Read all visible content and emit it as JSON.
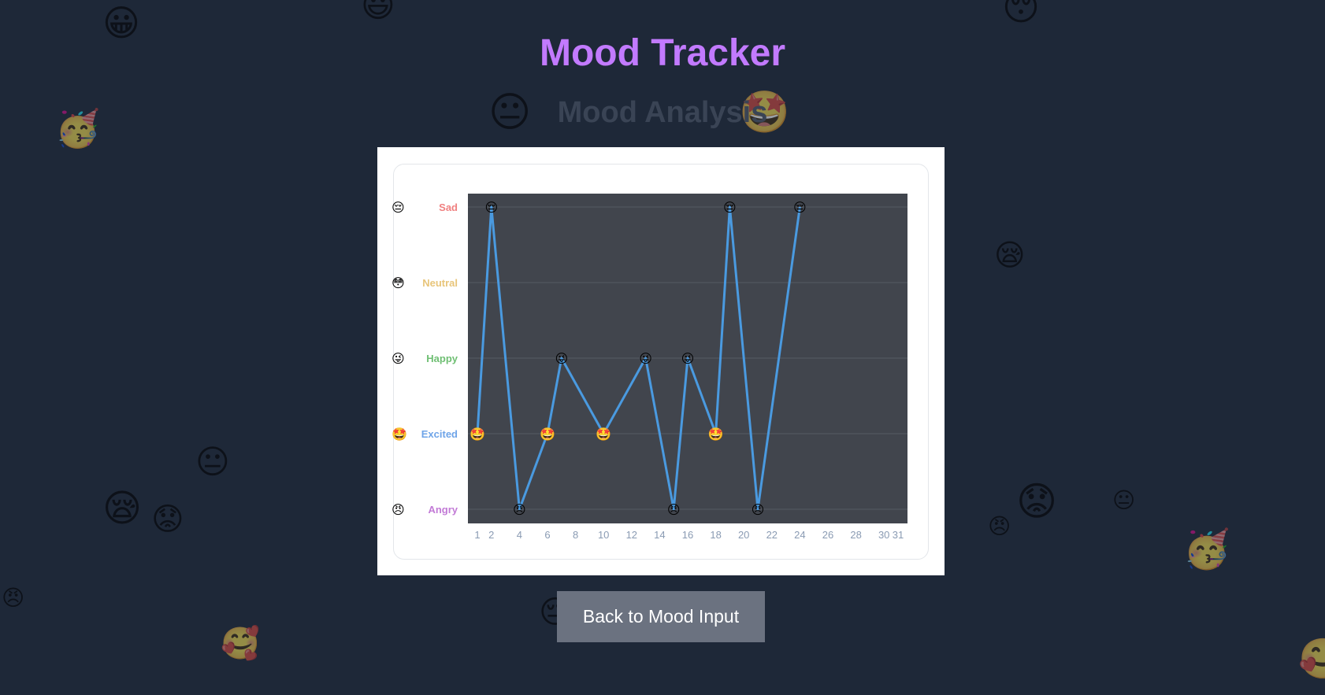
{
  "app": {
    "title": "Mood Tracker",
    "section_title": "Mood Analysis",
    "back_button_label": "Back to Mood Input"
  },
  "background_emojis": [
    {
      "glyph": "😀",
      "name": "grinning-emoji-icon"
    },
    {
      "glyph": "😃",
      "name": "smiley-emoji-icon"
    },
    {
      "glyph": "😴",
      "name": "sleeping-emoji-icon"
    },
    {
      "glyph": "🥳",
      "name": "party-emoji-icon"
    },
    {
      "glyph": "😐",
      "name": "neutral-emoji-icon"
    },
    {
      "glyph": "🤩",
      "name": "star-struck-emoji-icon"
    },
    {
      "glyph": "😪",
      "name": "sleepy-emoji-icon"
    },
    {
      "glyph": "😐",
      "name": "neutral-emoji-icon"
    },
    {
      "glyph": "😪",
      "name": "sleepy-emoji-icon"
    },
    {
      "glyph": "😟",
      "name": "worried-emoji-icon"
    },
    {
      "glyph": "😟",
      "name": "worried-emoji-icon"
    },
    {
      "glyph": "😐",
      "name": "neutral-emoji-icon"
    },
    {
      "glyph": "😠",
      "name": "angry-emoji-icon"
    },
    {
      "glyph": "🥳",
      "name": "party-emoji-icon"
    },
    {
      "glyph": "😠",
      "name": "angry-emoji-icon"
    },
    {
      "glyph": "🥰",
      "name": "smiling-hearts-emoji-icon"
    },
    {
      "glyph": "😔",
      "name": "pensive-emoji-icon"
    },
    {
      "glyph": "🥰",
      "name": "smiling-hearts-emoji-icon"
    }
  ],
  "chart_data": {
    "type": "line",
    "categories": [
      "Sad",
      "Neutral",
      "Happy",
      "Excited",
      "Angry"
    ],
    "category_colors": [
      "#f08080",
      "#e8c57a",
      "#6fbf73",
      "#6ea4e8",
      "#c27ad6"
    ],
    "category_emojis": [
      "😔",
      "😳",
      "😜",
      "🤩",
      "😠"
    ],
    "x": [
      1,
      2,
      4,
      6,
      7,
      10,
      13,
      15,
      16,
      18,
      19,
      21,
      24
    ],
    "y": [
      "Excited",
      "Sad",
      "Angry",
      "Excited",
      "Happy",
      "Excited",
      "Happy",
      "Angry",
      "Happy",
      "Excited",
      "Sad",
      "Angry",
      "Sad"
    ],
    "xlim": [
      1,
      31
    ],
    "xticks": [
      1,
      2,
      4,
      6,
      8,
      10,
      12,
      14,
      16,
      18,
      20,
      22,
      24,
      26,
      28,
      30,
      31
    ],
    "line_color": "#4a9ae0",
    "plot_background": "#41454d",
    "grid": true
  }
}
